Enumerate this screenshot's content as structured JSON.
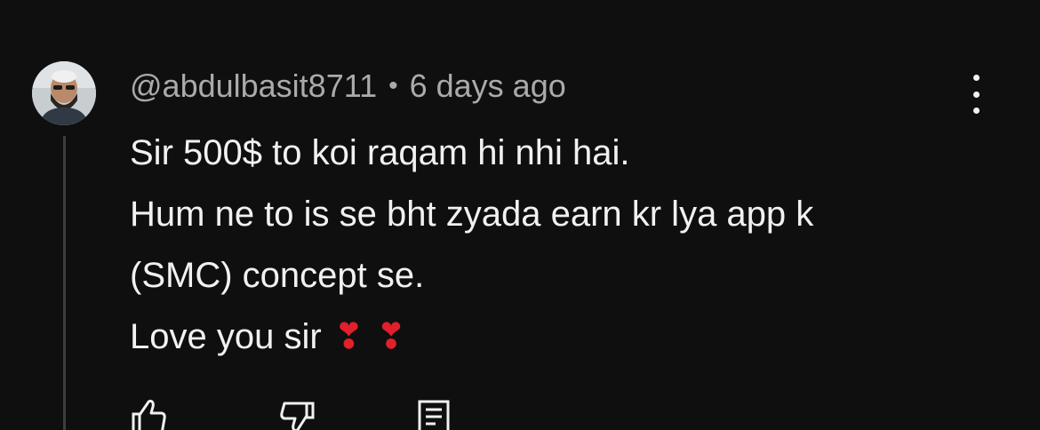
{
  "comment": {
    "author": "@abdulbasit8711",
    "separator": "•",
    "time": "6 days ago",
    "lines": [
      "Sir 500$ to koi raqam hi nhi hai.",
      "Hum ne to is se bht zyada earn kr lya app k",
      "(SMC) concept se.",
      "Love you sir"
    ],
    "emoji": [
      "❣",
      "❣"
    ]
  },
  "icons": {
    "menu": "more-vertical-icon",
    "like": "thumbs-up-icon",
    "dislike": "thumbs-down-icon",
    "reply": "reply-comment-icon"
  },
  "colors": {
    "background": "#0f0f0f",
    "text": "#f1f1f1",
    "meta_text": "#aaaaaa",
    "thread_line": "#3d3d3d",
    "heart": "#e0202b"
  }
}
